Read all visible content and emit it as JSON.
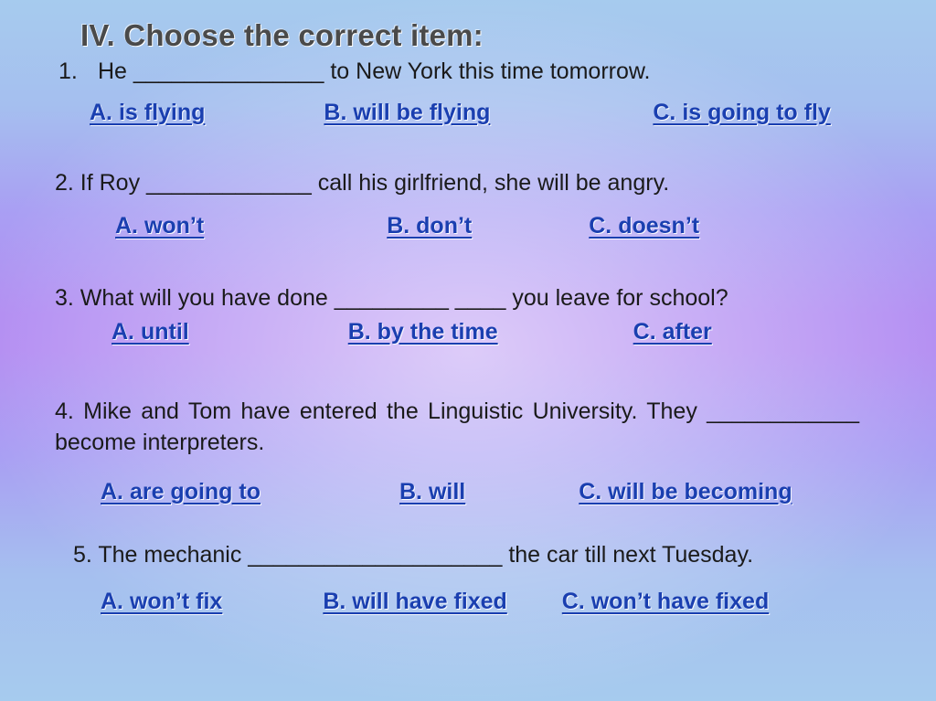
{
  "title": "IV. Choose the correct item:",
  "questions": {
    "q1": {
      "num": "1.",
      "text": "He _______________ to New York this time tomorrow.",
      "options": {
        "a": " A. is flying",
        "b": "B. will be flying",
        "c": "C. is going to fly"
      }
    },
    "q2": {
      "text": "2. If Roy _____________ call his girlfriend, she will be angry.",
      "options": {
        "a": "A. won’t",
        "b": "B. don’t",
        "c": "C. doesn’t"
      }
    },
    "q3": {
      "text": "3. What will you have done _________ ____ you leave for school?",
      "options": {
        "a": "A. until",
        "b": "B. by the time",
        "c": "C. after"
      }
    },
    "q4": {
      "text": "4. Mike and Tom have entered the Linguistic University. They ____________ become interpreters.",
      "options": {
        "a": "A. are going to",
        "b": "B. will",
        "c": "C. will be becoming"
      }
    },
    "q5": {
      "text": "5. The mechanic ____________________ the car till next Tuesday.",
      "options": {
        "a": "A. won’t fix",
        "b": "B. will have fixed",
        "c": "C. won’t have fixed"
      }
    }
  }
}
